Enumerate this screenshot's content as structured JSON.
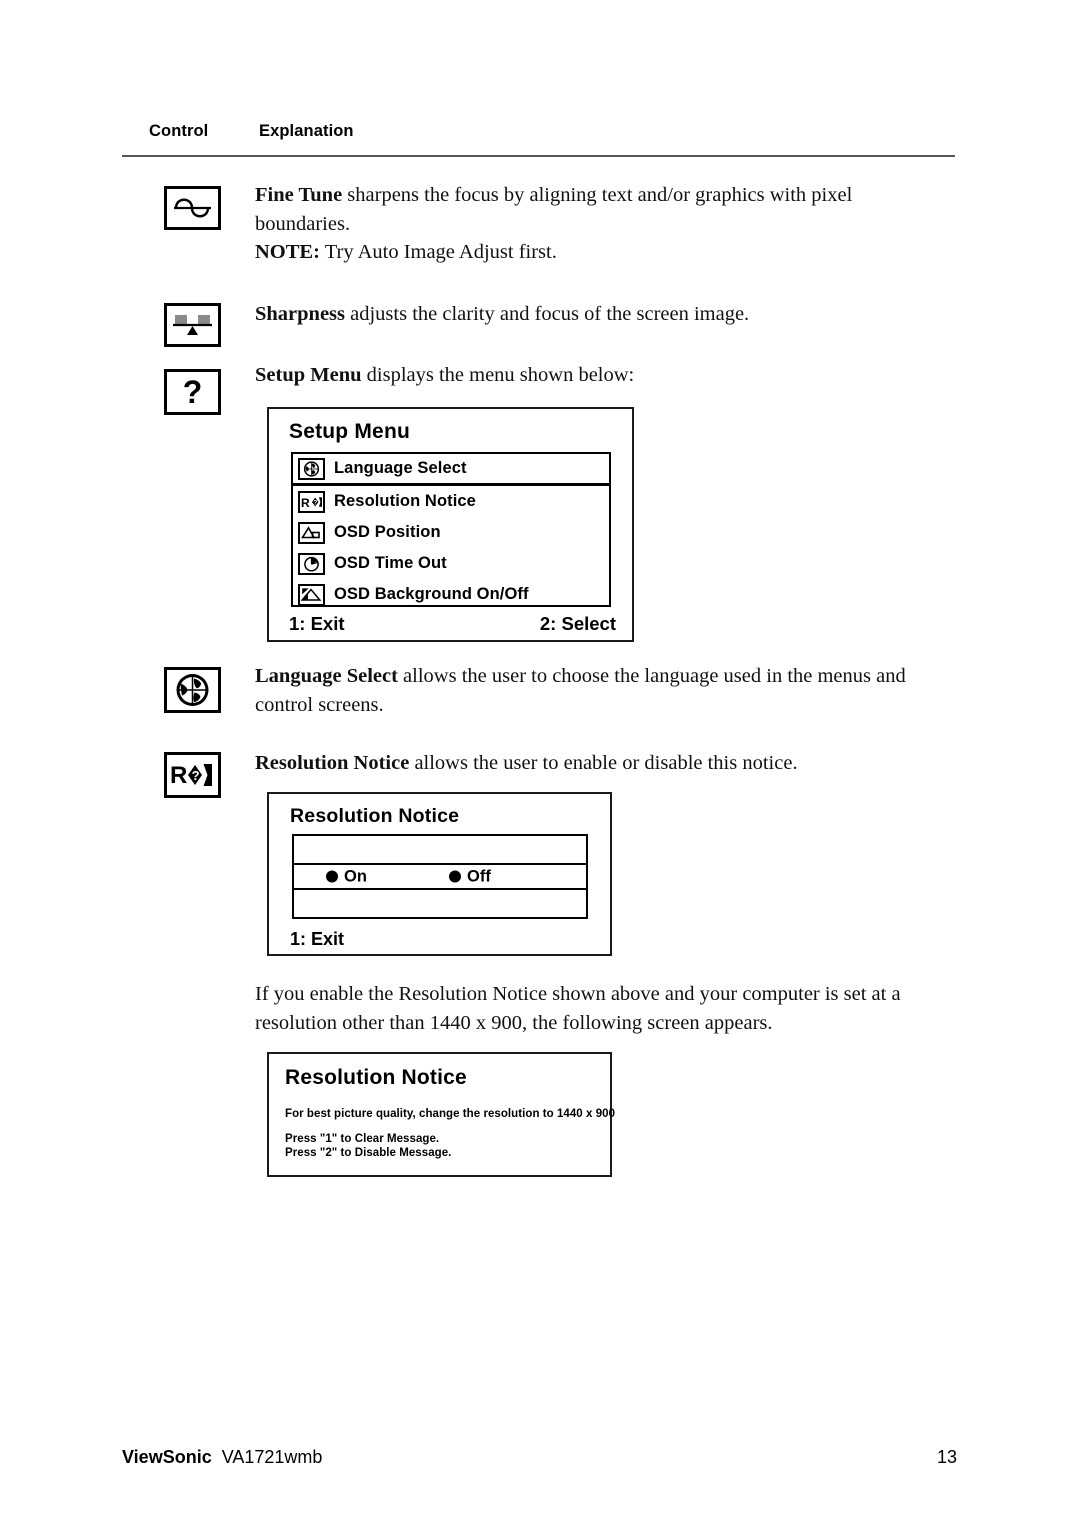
{
  "header": {
    "col1": "Control",
    "col2": "Explanation"
  },
  "entries": [
    {
      "icon": "fine-tune-icon",
      "term": "Fine Tune",
      "text": " sharpens the focus by aligning text and/or graphics with pixel boundaries.",
      "note_label": "NOTE:",
      "note_text": " Try Auto Image Adjust first."
    },
    {
      "icon": "sharpness-icon",
      "term": "Sharpness",
      "text": " adjusts the clarity and focus of the screen image."
    },
    {
      "icon": "question-mark-icon",
      "term": "Setup Menu",
      "text": " displays the menu shown below:"
    },
    {
      "icon": "globe-icon",
      "term": "Language Select",
      "text": " allows the user to choose the language used in the menus and control screens."
    },
    {
      "icon": "resolution-notice-icon",
      "term": "Resolution Notice",
      "text": " allows the user to enable or disable this notice."
    }
  ],
  "setup_menu": {
    "title": "Setup Menu",
    "items": [
      {
        "icon": "globe-icon",
        "label": "Language Select"
      },
      {
        "icon": "resolution-notice-icon",
        "label": "Resolution Notice"
      },
      {
        "icon": "osd-position-icon",
        "label": "OSD Position"
      },
      {
        "icon": "clock-icon",
        "label": "OSD Time Out"
      },
      {
        "icon": "osd-background-icon",
        "label": "OSD Background On/Off"
      }
    ],
    "footer_left": "1: Exit",
    "footer_right": "2: Select"
  },
  "resolution_notice_panel": {
    "title": "Resolution Notice",
    "option_on": "On",
    "option_off": "Off",
    "footer_left": "1: Exit"
  },
  "paragraph": {
    "text": "If you enable the Resolution Notice shown above and your computer is set at a resolution other than 1440 x 900, the following screen appears."
  },
  "resolution_message_panel": {
    "title": "Resolution Notice",
    "line1": "For best picture quality, change the resolution to 1440 x 900",
    "line2": "Press \"1\" to Clear Message.",
    "line3": "Press \"2\" to Disable Message."
  },
  "footer": {
    "brand": "ViewSonic",
    "model": "VA1721wmb",
    "page": "13"
  },
  "colors": {
    "ink": "#000000",
    "rule": "#58585a",
    "icon_gray": "#8a8a8a"
  }
}
